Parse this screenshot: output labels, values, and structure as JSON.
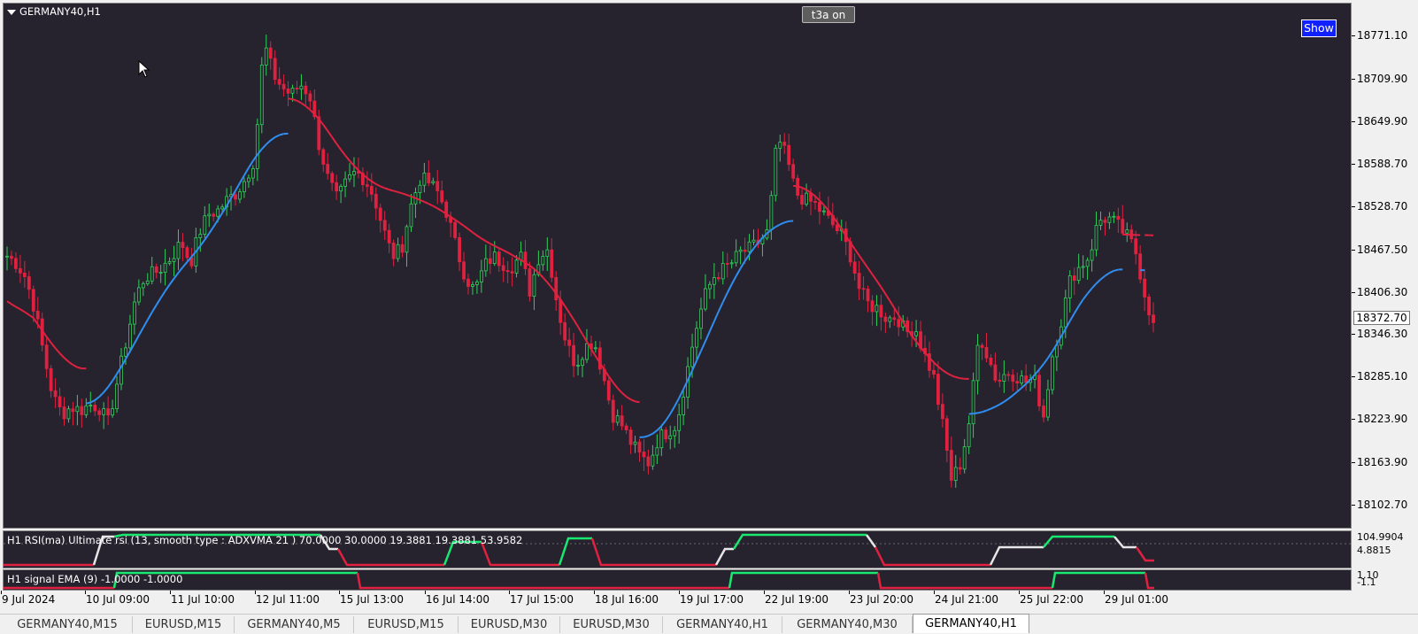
{
  "main_chart": {
    "title": "GERMANY40,H1",
    "t3a_button": "t3a on",
    "show_button": "Show",
    "current_price": "18372.70",
    "price_ticks": [
      "18771.10",
      "18709.90",
      "18649.90",
      "18588.70",
      "18528.70",
      "18467.50",
      "18406.30",
      "18346.30",
      "18285.10",
      "18223.90",
      "18163.90",
      "18102.70"
    ]
  },
  "rsi_pane": {
    "title": "H1 RSI(ma) Ultimate rsi (13, smooth type : ADXVMA  21 ) 70.0000 30.0000 19.3881 19.3881 53.9582",
    "axis_top": "104.9904",
    "axis_bottom": "4.8815"
  },
  "signal_pane": {
    "title": "H1 signal EMA (9) -1.0000 -1.0000",
    "axis_top": "1.10",
    "axis_bottom": "-1.1"
  },
  "time_axis": [
    "9 Jul 2024",
    "10 Jul 09:00",
    "11 Jul 10:00",
    "12 Jul 11:00",
    "15 Jul 13:00",
    "16 Jul 14:00",
    "17 Jul 15:00",
    "18 Jul 16:00",
    "19 Jul 17:00",
    "22 Jul 19:00",
    "23 Jul 20:00",
    "24 Jul 21:00",
    "25 Jul 22:00",
    "29 Jul 01:00"
  ],
  "tabs": [
    {
      "label": "GERMANY40,M15",
      "active": false
    },
    {
      "label": "EURUSD,M15",
      "active": false
    },
    {
      "label": "GERMANY40,M5",
      "active": false
    },
    {
      "label": "EURUSD,M15",
      "active": false
    },
    {
      "label": "EURUSD,M30",
      "active": false
    },
    {
      "label": "EURUSD,M30",
      "active": false
    },
    {
      "label": "GERMANY40,H1",
      "active": false
    },
    {
      "label": "GERMANY40,M30",
      "active": false
    },
    {
      "label": "GERMANY40,H1",
      "active": true
    }
  ],
  "colors": {
    "background": "#26232e",
    "bull_candle": "#2fd05a",
    "bear_candle": "#e0213f",
    "ma_up": "#2f8ef0",
    "ma_down": "#e0213f",
    "rsi_high": "#18e870",
    "rsi_mid": "#e6e6e6",
    "rsi_low": "#e0213f"
  },
  "chart_data": {
    "type": "candlestick",
    "symbol": "GERMANY40",
    "timeframe": "H1",
    "ylim": [
      18080,
      18830
    ],
    "close_path": [
      [
        0,
        18470
      ],
      [
        1,
        18460
      ],
      [
        2,
        18440
      ],
      [
        3,
        18395
      ],
      [
        4,
        18330
      ],
      [
        5,
        18270
      ],
      [
        6,
        18245
      ],
      [
        7,
        18255
      ],
      [
        8,
        18250
      ],
      [
        9,
        18258
      ],
      [
        10,
        18255
      ],
      [
        11,
        18232
      ],
      [
        12,
        18290
      ],
      [
        13,
        18350
      ],
      [
        14,
        18410
      ],
      [
        15,
        18440
      ],
      [
        16,
        18445
      ],
      [
        17,
        18455
      ],
      [
        18,
        18470
      ],
      [
        19,
        18490
      ],
      [
        20,
        18460
      ],
      [
        21,
        18505
      ],
      [
        22,
        18530
      ],
      [
        23,
        18535
      ],
      [
        24,
        18550
      ],
      [
        25,
        18560
      ],
      [
        26,
        18580
      ],
      [
        27,
        18610
      ],
      [
        28,
        18775
      ],
      [
        29,
        18730
      ],
      [
        30,
        18710
      ],
      [
        31,
        18700
      ],
      [
        32,
        18715
      ],
      [
        33,
        18700
      ],
      [
        34,
        18630
      ],
      [
        35,
        18580
      ],
      [
        36,
        18550
      ],
      [
        37,
        18575
      ],
      [
        38,
        18590
      ],
      [
        39,
        18580
      ],
      [
        40,
        18555
      ],
      [
        41,
        18510
      ],
      [
        42,
        18470
      ],
      [
        43,
        18480
      ],
      [
        44,
        18540
      ],
      [
        45,
        18580
      ],
      [
        46,
        18575
      ],
      [
        47,
        18560
      ],
      [
        48,
        18530
      ],
      [
        49,
        18480
      ],
      [
        50,
        18440
      ],
      [
        51,
        18420
      ],
      [
        52,
        18455
      ],
      [
        53,
        18470
      ],
      [
        54,
        18460
      ],
      [
        55,
        18455
      ],
      [
        56,
        18470
      ],
      [
        57,
        18420
      ],
      [
        58,
        18470
      ],
      [
        59,
        18480
      ],
      [
        60,
        18400
      ],
      [
        61,
        18345
      ],
      [
        62,
        18315
      ],
      [
        63,
        18340
      ],
      [
        64,
        18350
      ],
      [
        65,
        18300
      ],
      [
        66,
        18245
      ],
      [
        67,
        18230
      ],
      [
        68,
        18205
      ],
      [
        69,
        18185
      ],
      [
        70,
        18175
      ],
      [
        71,
        18210
      ],
      [
        72,
        18220
      ],
      [
        73,
        18230
      ],
      [
        74,
        18295
      ],
      [
        75,
        18360
      ],
      [
        76,
        18410
      ],
      [
        77,
        18440
      ],
      [
        78,
        18450
      ],
      [
        79,
        18460
      ],
      [
        80,
        18475
      ],
      [
        81,
        18480
      ],
      [
        82,
        18490
      ],
      [
        83,
        18505
      ],
      [
        84,
        18640
      ],
      [
        85,
        18610
      ],
      [
        86,
        18560
      ],
      [
        87,
        18550
      ],
      [
        88,
        18545
      ],
      [
        89,
        18530
      ],
      [
        90,
        18515
      ],
      [
        91,
        18500
      ],
      [
        92,
        18470
      ],
      [
        93,
        18420
      ],
      [
        94,
        18400
      ],
      [
        95,
        18395
      ],
      [
        96,
        18380
      ],
      [
        97,
        18385
      ],
      [
        98,
        18360
      ],
      [
        99,
        18370
      ],
      [
        100,
        18330
      ],
      [
        101,
        18300
      ],
      [
        102,
        18230
      ],
      [
        103,
        18150
      ],
      [
        104,
        18175
      ],
      [
        105,
        18240
      ],
      [
        106,
        18360
      ],
      [
        107,
        18325
      ],
      [
        108,
        18290
      ],
      [
        109,
        18305
      ],
      [
        110,
        18300
      ],
      [
        111,
        18290
      ],
      [
        112,
        18295
      ],
      [
        113,
        18240
      ],
      [
        114,
        18330
      ],
      [
        115,
        18380
      ],
      [
        116,
        18440
      ],
      [
        117,
        18455
      ],
      [
        118,
        18470
      ],
      [
        119,
        18520
      ],
      [
        120,
        18525
      ],
      [
        121,
        18515
      ],
      [
        122,
        18500
      ],
      [
        123,
        18480
      ],
      [
        124,
        18420
      ],
      [
        125,
        18370
      ]
    ]
  }
}
